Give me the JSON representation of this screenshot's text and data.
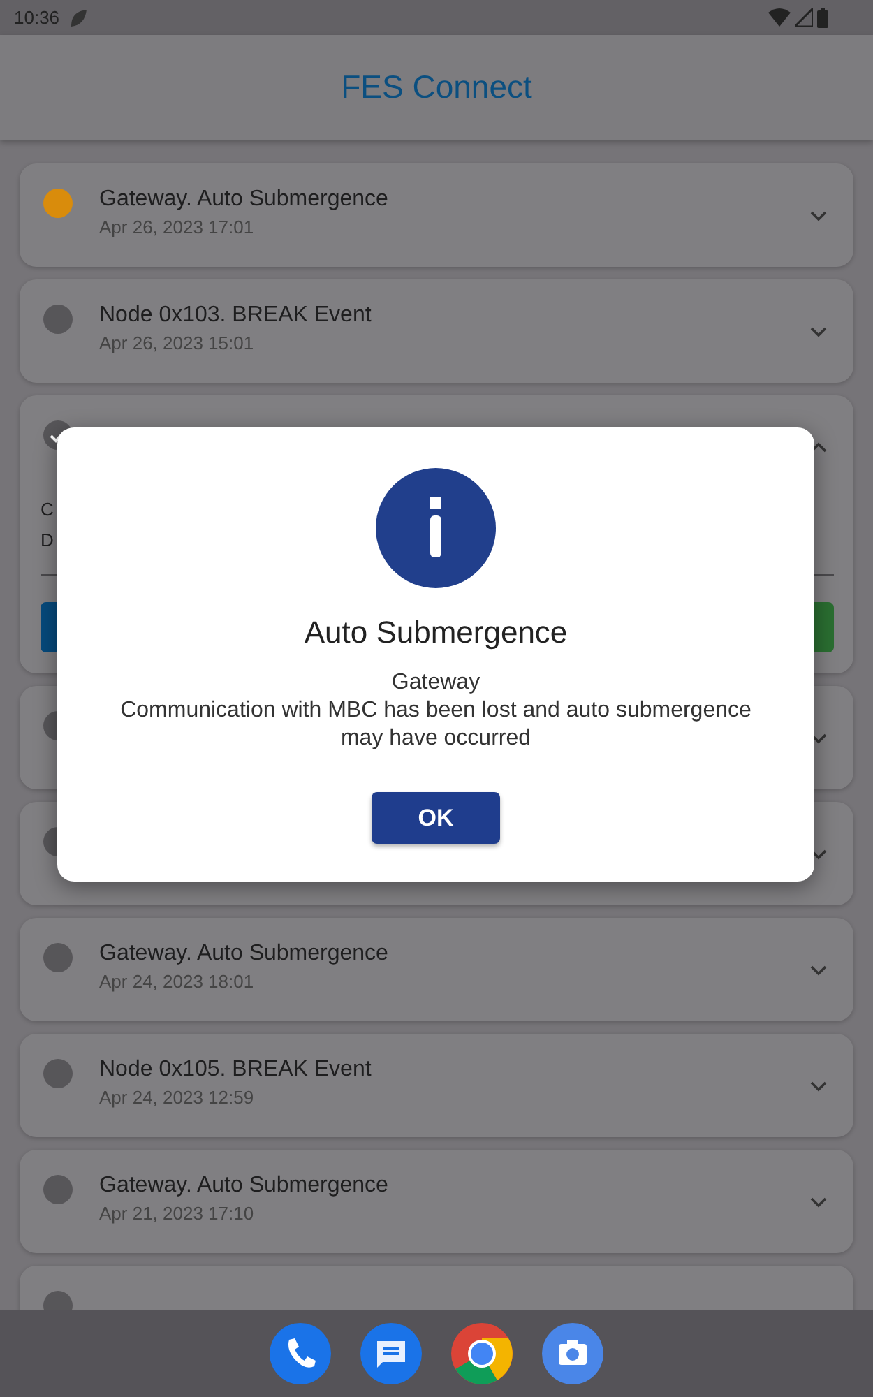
{
  "status_bar": {
    "time": "10:36"
  },
  "app_bar": {
    "title": "FES Connect"
  },
  "events": [
    {
      "kind": "dot",
      "color": "#d98c0c",
      "title": "Gateway. Auto Submergence",
      "date": "Apr 26, 2023 17:01",
      "expanded": false
    },
    {
      "kind": "dot",
      "color": "#575659",
      "title": "Node 0x103. BREAK Event",
      "date": "Apr 26, 2023 15:01",
      "expanded": false
    },
    {
      "kind": "check",
      "expanded": true,
      "details": [
        "C",
        "D"
      ]
    },
    {
      "kind": "dot",
      "color": "#575659",
      "expanded": false
    },
    {
      "kind": "dot",
      "color": "#575659",
      "expanded": false
    },
    {
      "kind": "dot",
      "color": "#575659",
      "title": "Gateway. Auto Submergence",
      "date": "Apr 24, 2023 18:01",
      "expanded": false
    },
    {
      "kind": "dot",
      "color": "#575659",
      "title": "Node 0x105. BREAK Event",
      "date": "Apr 24, 2023 12:59",
      "expanded": false
    },
    {
      "kind": "dot",
      "color": "#575659",
      "title": "Gateway. Auto Submergence",
      "date": "Apr 21, 2023 17:10",
      "expanded": false
    },
    {
      "kind": "dot",
      "color": "#575659"
    }
  ],
  "dialog": {
    "title": "Auto Submergence",
    "source": "Gateway",
    "message": "Communication with MBC has been lost and auto submergence may have occurred",
    "button": "OK"
  }
}
